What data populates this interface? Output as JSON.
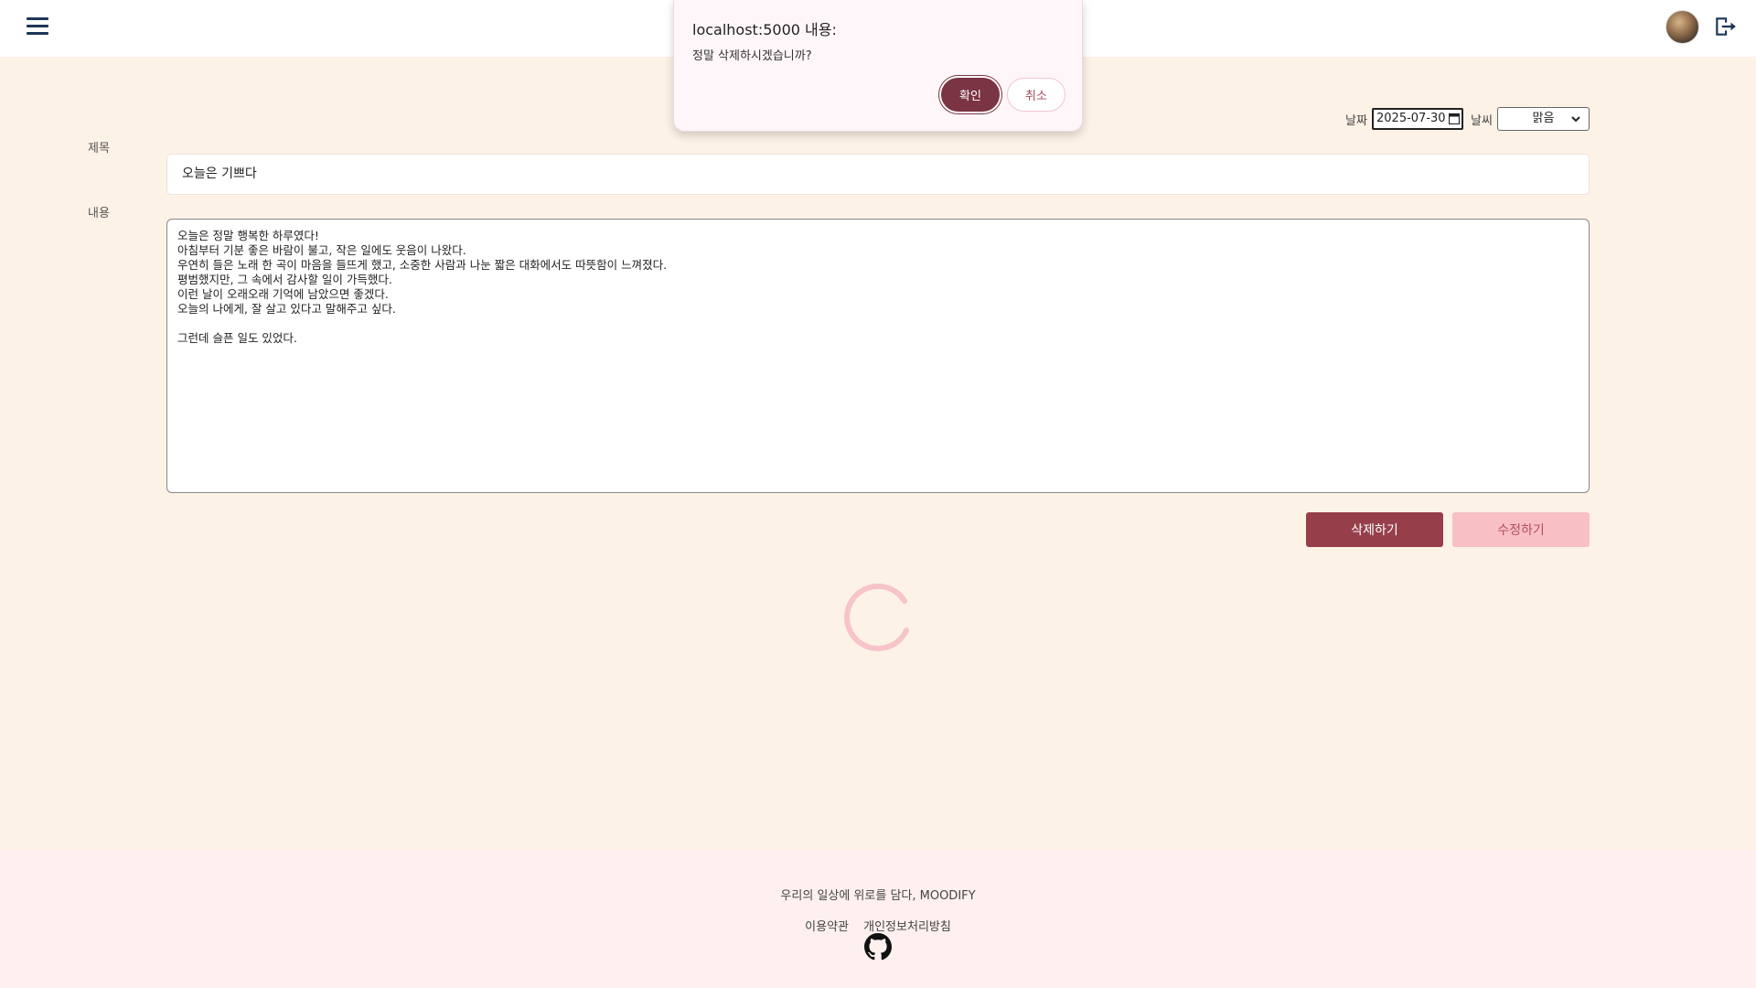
{
  "header": {
    "menu_icon": "hamburger-menu-icon",
    "avatar_icon": "user-avatar",
    "logout_icon": "logout-icon"
  },
  "dialog": {
    "title": "localhost:5000 내용:",
    "message": "정말 삭제하시겠습니까?",
    "ok_label": "확인",
    "cancel_label": "취소"
  },
  "meta": {
    "date_label": "날짜",
    "date_value": "2025-07-30",
    "weather_label": "날씨",
    "weather_value": "맑음"
  },
  "form": {
    "title_label": "제목",
    "title_value": "오늘은 기쁘다",
    "content_label": "내용",
    "content_value": "오늘은 정말 행복한 하루였다!\n아침부터 기분 좋은 바람이 불고, 작은 일에도 웃음이 나왔다.\n우연히 들은 노래 한 곡이 마음을 들뜨게 했고, 소중한 사람과 나눈 짧은 대화에서도 따뜻함이 느껴졌다.\n평범했지만, 그 속에서 감사할 일이 가득했다.\n이런 날이 오래오래 기억에 남았으면 좋겠다.\n오늘의 나에게, 잘 살고 있다고 말해주고 싶다.\n\n그런데 슬픈 일도 있었다.",
    "delete_label": "삭제하기",
    "edit_label": "수정하기"
  },
  "footer": {
    "slogan": "우리의 일상에 위로를 담다, MOODIFY",
    "terms_label": "이용약관",
    "privacy_label": "개인정보처리방침",
    "github_icon": "github-icon"
  },
  "colors": {
    "background": "#fdf2e6",
    "primary": "#963f4b",
    "secondary": "#f8bfc5",
    "header_icon": "#1d3557"
  }
}
